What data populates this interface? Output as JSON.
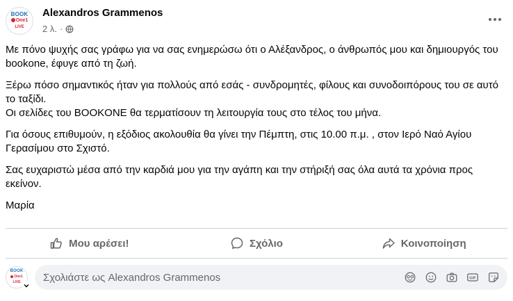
{
  "post": {
    "author": "Alexandros Grammenos",
    "time": "2 λ.",
    "separator": "·",
    "avatar_logo": {
      "top": "BOOK",
      "middle": "One1",
      "bottom": "LIVE"
    },
    "paragraphs": [
      "Με πόνο ψυχής σας γράφω για να σας ενημερώσω ότι ο Αλέξανδρος, ο άνθρωπός μου και δημιουργός του bookone, έφυγε από τη ζωή.",
      "Ξέρω πόσο σημαντικός ήταν για πολλούς από εσάς - συνδρομητές, φίλους και συνοδοιπόρους του σε αυτό το ταξίδι.",
      "Οι σελίδες του BOOKONE θα τερματίσουν τη λειτουργία τους στο τέλος του μήνα.",
      "Για όσους επιθυμούν, η εξόδιος ακολουθία θα γίνει την Πέμπτη, στις 10.00 π.μ. , στον Ιερό Ναό Αγίου Γερασίμου στο Σχιστό.",
      "Σας ευχαριστώ μέσα από την καρδιά μου για την αγάπη και την στήριξή σας όλα αυτά τα χρόνια προς εκείνον.",
      "Μαρία"
    ]
  },
  "actions": {
    "like": "Μου αρέσει!",
    "comment": "Σχόλιο",
    "share": "Κοινοποίηση"
  },
  "comment_box": {
    "placeholder": "Σχολιάστε ως Alexandros Grammenos",
    "icons": [
      "avatar-sticker-icon",
      "emoji-icon",
      "camera-icon",
      "gif-icon",
      "sticker-icon"
    ]
  },
  "colors": {
    "text": "#050505",
    "secondary": "#65676b",
    "divider": "#ced0d4",
    "input_bg": "#f0f2f5",
    "logo_blue": "#1f6fb5",
    "logo_red": "#d8262f"
  }
}
